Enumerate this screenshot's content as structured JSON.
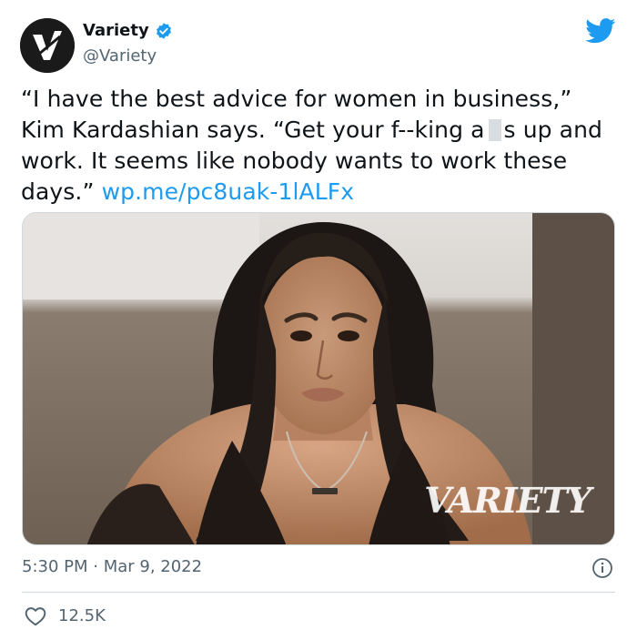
{
  "account": {
    "display_name": "Variety",
    "handle": "@Variety",
    "verified": true,
    "avatar_icon": "variety-v-logo"
  },
  "tweet": {
    "text_part1": "“I have the best advice for women in business,” Kim Kardashian says. “Get your f--king a",
    "text_part2": "s up and work. It seems like nobody wants to work these days.”",
    "link": "wp.me/pc8uak-1lALFx"
  },
  "media": {
    "watermark": "VARIETY"
  },
  "meta": {
    "timestamp": "5:30 PM · Mar 9, 2022",
    "like_count": "12.5K"
  },
  "colors": {
    "brand_blue": "#1d9bf0",
    "secondary_text": "#536471",
    "divider": "#cfd9de"
  }
}
